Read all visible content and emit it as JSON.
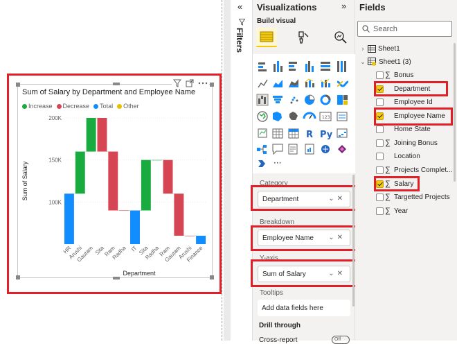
{
  "canvas": {
    "visual": {
      "title": "Sum of Salary by Department and Employee Name",
      "legend": [
        {
          "label": "Increase",
          "color": "#1aab40"
        },
        {
          "label": "Decrease",
          "color": "#d64554"
        },
        {
          "label": "Total",
          "color": "#118dff"
        },
        {
          "label": "Other",
          "color": "#e6c000"
        }
      ],
      "header_icons": [
        "filter-icon",
        "focus-mode-icon",
        "more-options-icon"
      ]
    }
  },
  "chart_data": {
    "type": "waterfall",
    "title": "Sum of Salary by Department and Employee Name",
    "xlabel": "Department",
    "ylabel": "Sum of Salary",
    "ylim": [
      50000,
      200000
    ],
    "yticks": [
      "100K",
      "150K",
      "200K"
    ],
    "categories": [
      "HR",
      "Arushi",
      "Gautam",
      "Sita",
      "Ram",
      "Radha",
      "IT",
      "Sita",
      "Radha",
      "Ram",
      "Gautam",
      "Arushi",
      "Finance"
    ],
    "steps": [
      {
        "label": "HR",
        "kind": "total",
        "start": 0,
        "end": 110000
      },
      {
        "label": "Arushi",
        "kind": "increase",
        "start": 110000,
        "end": 160000
      },
      {
        "label": "Gautam",
        "kind": "increase",
        "start": 160000,
        "end": 200000
      },
      {
        "label": "Sita",
        "kind": "decrease",
        "start": 200000,
        "end": 160000
      },
      {
        "label": "Ram",
        "kind": "decrease",
        "start": 160000,
        "end": 90000
      },
      {
        "label": "Radha",
        "kind": "decrease",
        "start": 90000,
        "end": 90000
      },
      {
        "label": "IT",
        "kind": "total",
        "start": 0,
        "end": 90000
      },
      {
        "label": "Sita",
        "kind": "increase",
        "start": 90000,
        "end": 150000
      },
      {
        "label": "Radha",
        "kind": "increase",
        "start": 150000,
        "end": 150000
      },
      {
        "label": "Ram",
        "kind": "decrease",
        "start": 150000,
        "end": 110000
      },
      {
        "label": "Gautam",
        "kind": "decrease",
        "start": 110000,
        "end": 60000
      },
      {
        "label": "Arushi",
        "kind": "decrease",
        "start": 60000,
        "end": 60000
      },
      {
        "label": "Finance",
        "kind": "total",
        "start": 0,
        "end": 60000
      }
    ],
    "colors": {
      "increase": "#1aab40",
      "decrease": "#d64554",
      "total": "#118dff"
    },
    "grid": true,
    "legend_position": "top-left"
  },
  "filters": {
    "label": "Filters"
  },
  "visualizations": {
    "title": "Visualizations",
    "subtitle": "Build visual",
    "extra_icons": "···",
    "sections": {
      "category": {
        "label": "Category",
        "value": "Department"
      },
      "breakdown": {
        "label": "Breakdown",
        "value": "Employee Name"
      },
      "yaxis": {
        "label": "Y-axis",
        "value": "Sum of Salary"
      },
      "tooltips": {
        "label": "Tooltips",
        "placeholder": "Add data fields here"
      },
      "drill": {
        "label": "Drill through"
      },
      "cross_report": {
        "label": "Cross-report",
        "toggle": "Off"
      }
    }
  },
  "fields": {
    "title": "Fields",
    "search_placeholder": "Search",
    "tables": [
      {
        "name": "Sheet1",
        "expanded": false
      },
      {
        "name": "Sheet1 (3)",
        "expanded": true
      }
    ],
    "columns": [
      {
        "name": "Bonus",
        "sigma": true,
        "checked": false
      },
      {
        "name": "Department",
        "sigma": false,
        "checked": true
      },
      {
        "name": "Employee Id",
        "sigma": false,
        "checked": false
      },
      {
        "name": "Employee Name",
        "sigma": false,
        "checked": true
      },
      {
        "name": "Home State",
        "sigma": false,
        "checked": false
      },
      {
        "name": "Joining Bonus",
        "sigma": true,
        "checked": false
      },
      {
        "name": "Location",
        "sigma": false,
        "checked": false
      },
      {
        "name": "Projects Complet...",
        "sigma": true,
        "checked": false
      },
      {
        "name": "Salary",
        "sigma": true,
        "checked": true
      },
      {
        "name": "Targetted Projects",
        "sigma": true,
        "checked": false
      },
      {
        "name": "Year",
        "sigma": true,
        "checked": false
      }
    ]
  }
}
